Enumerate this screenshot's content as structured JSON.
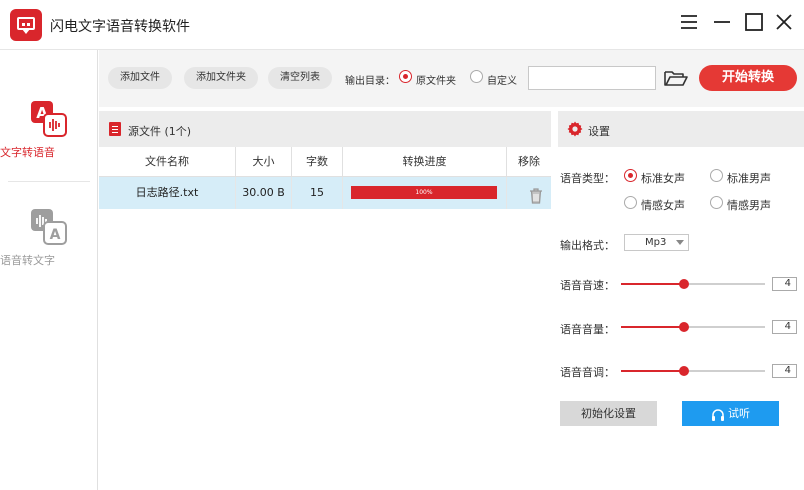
{
  "window": {
    "title": "闪电文字语音转换软件"
  },
  "sidebar": {
    "items": [
      {
        "label": "文字转语音",
        "icon": "text-to-speech-icon",
        "active": true
      },
      {
        "label": "语音转文字",
        "icon": "speech-to-text-icon",
        "active": false
      }
    ]
  },
  "toolbar": {
    "add_file": "添加文件",
    "add_folder": "添加文件夹",
    "clear_list": "清空列表",
    "output_dir_label": "输出目录：",
    "output_options": [
      {
        "label": "原文件夹",
        "selected": true
      },
      {
        "label": "自定义",
        "selected": false
      }
    ],
    "custom_path": "",
    "start": "开始转换"
  },
  "file_panel": {
    "title": "源文件 (1个)",
    "columns": [
      "文件名称",
      "大小",
      "字数",
      "转换进度",
      "移除"
    ],
    "rows": [
      {
        "name": "日志路径.txt",
        "size": "30.00 B",
        "chars": "15",
        "progress_label": "100%",
        "progress": 1.0
      }
    ]
  },
  "settings": {
    "title": "设置",
    "voice_type_label": "语音类型：",
    "voice_options": [
      {
        "label": "标准女声",
        "selected": true
      },
      {
        "label": "标准男声",
        "selected": false
      },
      {
        "label": "情感女声",
        "selected": false
      },
      {
        "label": "情感男声",
        "selected": false
      }
    ],
    "format_label": "输出格式：",
    "format_value": "Mp3",
    "speed": {
      "label": "语音音速：",
      "value": "4",
      "level": 0.44
    },
    "volume": {
      "label": "语音音量：",
      "value": "4",
      "level": 0.44
    },
    "pitch": {
      "label": "语音音调：",
      "value": "4",
      "level": 0.44
    },
    "reset": "初始化设置",
    "listen": "试听"
  },
  "colors": {
    "accent": "#d9262c",
    "start_button": "#e53935",
    "listen_button": "#1e9bf0",
    "selected_row": "#d6edf8"
  }
}
